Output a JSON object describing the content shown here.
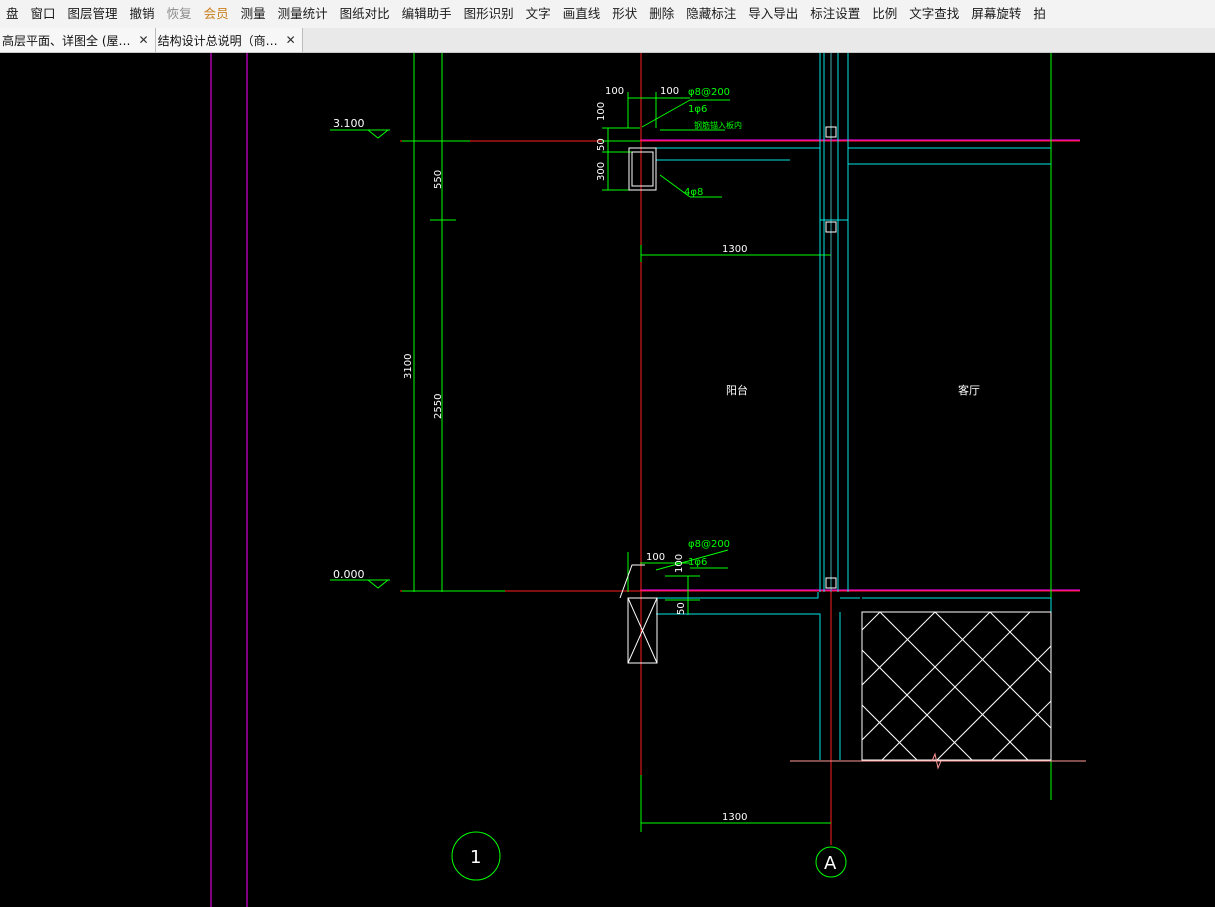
{
  "toolbar": {
    "items": [
      {
        "label": "盘",
        "state": "normal"
      },
      {
        "label": "窗口",
        "state": "normal"
      },
      {
        "label": "图层管理",
        "state": "normal"
      },
      {
        "label": "撤销",
        "state": "normal"
      },
      {
        "label": "恢复",
        "state": "disabled"
      },
      {
        "label": "会员",
        "state": "vip"
      },
      {
        "label": "测量",
        "state": "normal"
      },
      {
        "label": "测量统计",
        "state": "normal"
      },
      {
        "label": "图纸对比",
        "state": "normal"
      },
      {
        "label": "编辑助手",
        "state": "normal"
      },
      {
        "label": "图形识别",
        "state": "normal"
      },
      {
        "label": "文字",
        "state": "normal"
      },
      {
        "label": "画直线",
        "state": "normal"
      },
      {
        "label": "形状",
        "state": "normal"
      },
      {
        "label": "删除",
        "state": "normal"
      },
      {
        "label": "隐藏标注",
        "state": "normal"
      },
      {
        "label": "导入导出",
        "state": "normal"
      },
      {
        "label": "标注设置",
        "state": "normal"
      },
      {
        "label": "比例",
        "state": "normal"
      },
      {
        "label": "文字查找",
        "state": "normal"
      },
      {
        "label": "屏幕旋转",
        "state": "normal"
      },
      {
        "label": "拍",
        "state": "normal"
      }
    ]
  },
  "tabs": [
    {
      "label": "高层平面、详图全 (屋…",
      "close": "✕"
    },
    {
      "label": "结构设计总说明（商…",
      "close": "✕"
    }
  ],
  "drawing": {
    "levels": [
      "3.100",
      "0.000"
    ],
    "dims": {
      "d100a": "100",
      "d100b": "100",
      "d100v": "100",
      "d50": "50",
      "d300": "300",
      "d550": "550",
      "d3100": "3100",
      "d2550": "2550",
      "d1300_top": "1300",
      "d1300_bottom": "1300",
      "d100_bottom": "100",
      "d100v_bottom": "100",
      "d50_bottom": "50"
    },
    "rebar": {
      "top_stirrup": "φ8@200",
      "top_bar": "1φ6",
      "top_note": "钢筋锚入板内",
      "top_long": "4φ8",
      "bottom_stirrup": "φ8@200",
      "bottom_bar": "1φ6"
    },
    "rooms": [
      "阳台",
      "客厅"
    ],
    "axes": [
      "1",
      "A"
    ],
    "colors": {
      "background": "#000000",
      "dim": "#00ff00",
      "axis": "#ff0000",
      "wall": "#00ffff",
      "magenta": "#ff00ff",
      "white": "#ffffff",
      "hatch": "#ffffff",
      "ground": "#ff9999"
    }
  }
}
